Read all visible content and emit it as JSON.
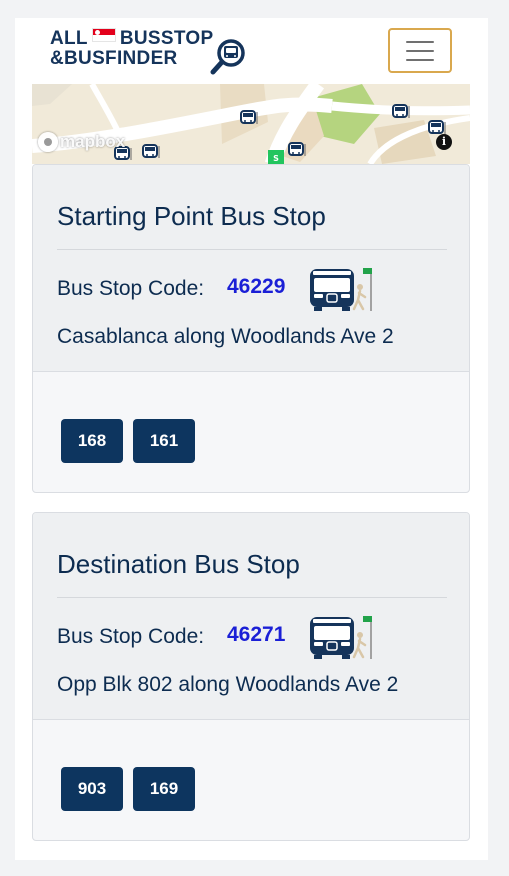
{
  "header": {
    "brand_line1_left": "ALL",
    "brand_line1_right": "BUSSTOP",
    "brand_line2": "&BUSFINDER",
    "brand_flag_icon": "singapore-flag-icon",
    "brand_search_icon": "bus-search-icon",
    "menu_icon": "hamburger-menu-icon",
    "brand_color": "#15345b",
    "menu_border_color": "#d9a84e"
  },
  "map": {
    "attribution_logo": "mapbox",
    "info_glyph": "i",
    "info_icon": "info-icon",
    "marker_icon": "bus-stop-marker-icon",
    "road_color": "#ffffff",
    "land_color": "#f1ead9",
    "park_color": "#b5d47f"
  },
  "starting_stop": {
    "title": "Starting Point Bus Stop",
    "code_label": "Bus Stop Code:",
    "code": "46229",
    "stop_icon": "bus-stop-icon",
    "name": "Casablanca along Woodlands Ave 2",
    "services": [
      "168",
      "161"
    ]
  },
  "destination_stop": {
    "title": "Destination Bus Stop",
    "code_label": "Bus Stop Code:",
    "code": "46271",
    "stop_icon": "bus-stop-icon",
    "name": "Opp Blk 802 along Woodlands Ave 2",
    "services": [
      "903",
      "169"
    ]
  },
  "colors": {
    "heading": "#0d2c50",
    "code_link": "#1a1fd6",
    "service_button": "#0d355f"
  }
}
